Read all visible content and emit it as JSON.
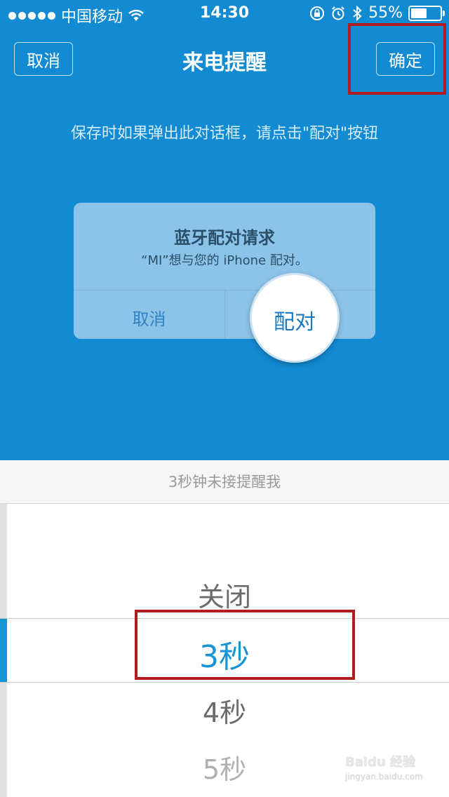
{
  "status_bar": {
    "carrier": "中国移动",
    "time": "14:30",
    "battery_percent": "55%",
    "battery_level": 0.55,
    "icons": [
      "signal-dots-icon",
      "wifi-icon",
      "rotation-lock-icon",
      "alarm-icon",
      "bluetooth-icon",
      "battery-icon"
    ]
  },
  "nav": {
    "cancel_label": "取消",
    "title": "来电提醒",
    "confirm_label": "确定"
  },
  "hint": "保存时如果弹出此对话框，请点击\"配对\"按钮",
  "dialog": {
    "title": "蓝牙配对请求",
    "message": "“MI”想与您的 iPhone 配对。",
    "cancel_label": "取消",
    "pair_label": "配对"
  },
  "picker": {
    "header": "3秒钟未接提醒我",
    "options": [
      "关闭",
      "3秒",
      "4秒",
      "5秒"
    ],
    "selected": "3秒"
  },
  "watermark": {
    "logo_text": "Baidu 经验",
    "url": "jingyan.baidu.com"
  },
  "colors": {
    "primary": "#138bd2",
    "accent": "#1794d3",
    "highlight_box": "#b21c1e"
  }
}
